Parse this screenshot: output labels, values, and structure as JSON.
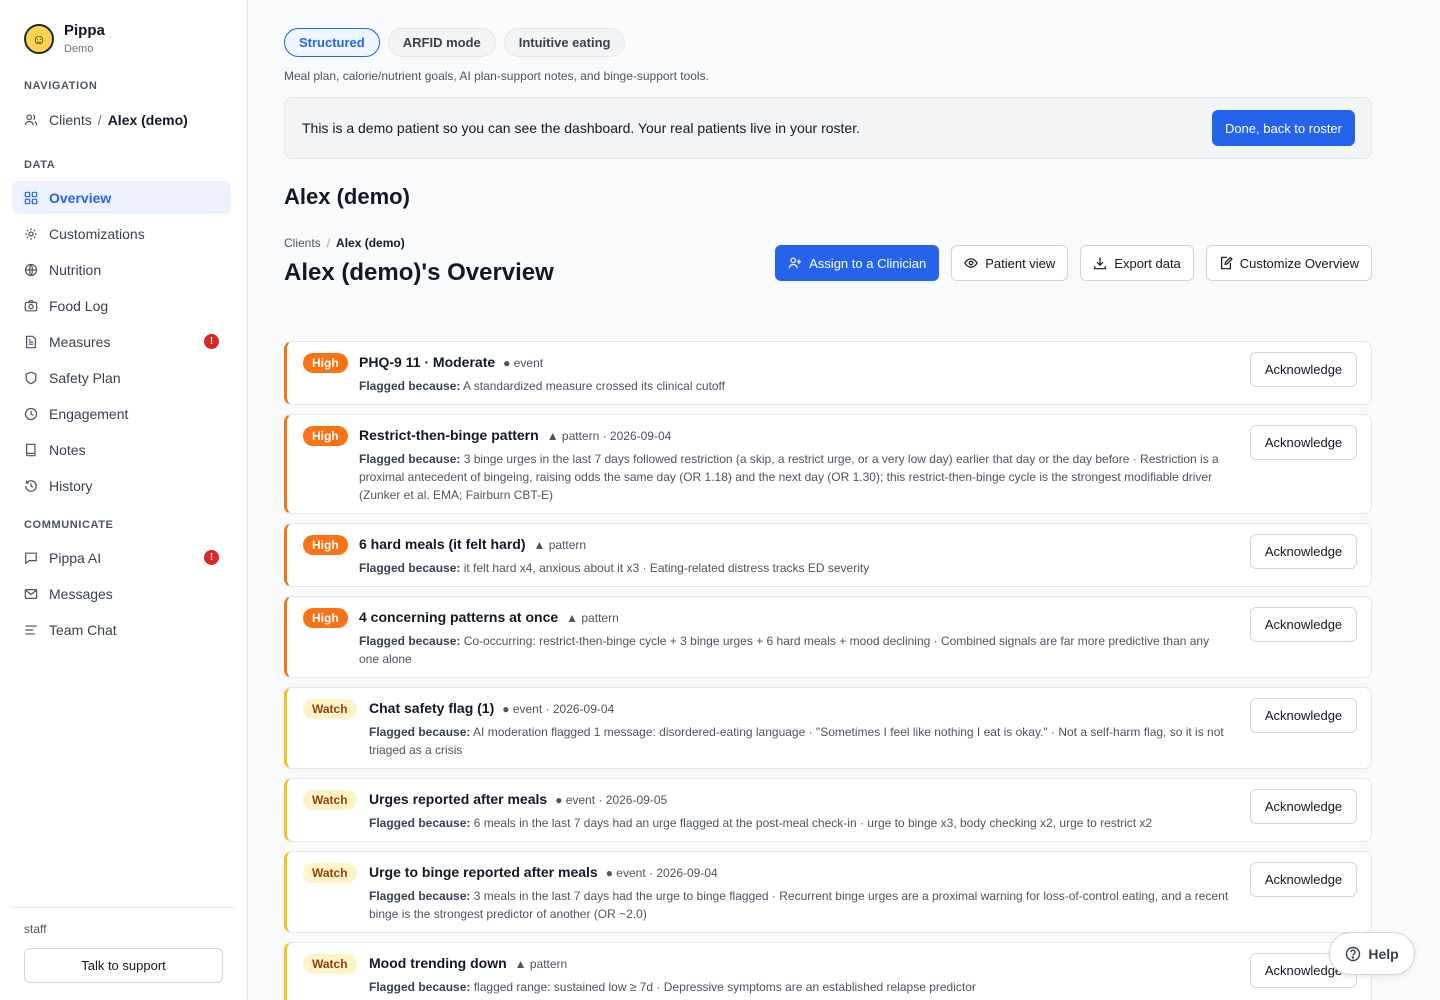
{
  "brand": {
    "name": "Pippa",
    "sub": "Demo"
  },
  "sidebar": {
    "nav_label": "NAVIGATION",
    "crumb": {
      "parent": "Clients",
      "sep": "/",
      "current": "Alex (demo)"
    },
    "data_label": "DATA",
    "data_items": [
      {
        "label": "Overview",
        "icon": "grid-icon"
      },
      {
        "label": "Customizations",
        "icon": "gear-icon"
      },
      {
        "label": "Nutrition",
        "icon": "globe-icon"
      },
      {
        "label": "Food Log",
        "icon": "camera-icon"
      },
      {
        "label": "Measures",
        "icon": "document-icon",
        "badge": "!"
      },
      {
        "label": "Safety Plan",
        "icon": "shield-icon"
      },
      {
        "label": "Engagement",
        "icon": "clock-icon"
      },
      {
        "label": "Notes",
        "icon": "book-icon"
      },
      {
        "label": "History",
        "icon": "history-icon"
      }
    ],
    "communicate_label": "COMMUNICATE",
    "communicate_items": [
      {
        "label": "Pippa AI",
        "icon": "chat-icon",
        "badge": "!"
      },
      {
        "label": "Messages",
        "icon": "mail-icon"
      },
      {
        "label": "Team Chat",
        "icon": "lines-icon"
      }
    ],
    "footer_label": "staff",
    "support_label": "Talk to support"
  },
  "modes": {
    "tabs": [
      "Structured",
      "ARFID mode",
      "Intuitive eating"
    ],
    "active": "Structured",
    "description": "Meal plan, calorie/nutrient goals, AI plan-support notes, and binge-support tools."
  },
  "banner": {
    "text": "This is a demo patient so you can see the dashboard. Your real patients live in your roster.",
    "button": "Done, back to roster"
  },
  "patient": {
    "title": "Alex (demo)"
  },
  "breadcrumb": {
    "parent": "Clients",
    "sep": "/",
    "current": "Alex (demo)"
  },
  "overview_title": "Alex (demo)'s Overview",
  "actions": {
    "assign": "Assign to a Clinician",
    "patient_view": "Patient view",
    "export": "Export data",
    "customize": "Customize Overview"
  },
  "alerts": [
    {
      "severity": "High",
      "title": "PHQ-9 11 · Moderate",
      "meta": "● event",
      "prefix": "Flagged because:",
      "body": "A standardized measure crossed its clinical cutoff"
    },
    {
      "severity": "High",
      "title": "Restrict-then-binge pattern",
      "meta": "▲ pattern · 2026-09-04",
      "prefix": "Flagged because:",
      "body": "3 binge urges in the last 7 days followed restriction (a skip, a restrict urge, or a very low day) earlier that day or the day before · Restriction is a proximal antecedent of bingeing, raising odds the same day (OR 1.18) and the next day (OR 1.30); this restrict-then-binge cycle is the strongest modifiable driver (Zunker et al. EMA; Fairburn CBT-E)"
    },
    {
      "severity": "High",
      "title": "6 hard meals (it felt hard)",
      "meta": "▲ pattern",
      "prefix": "Flagged because:",
      "body": "it felt hard x4, anxious about it x3 · Eating-related distress tracks ED severity"
    },
    {
      "severity": "High",
      "title": "4 concerning patterns at once",
      "meta": "▲ pattern",
      "prefix": "Flagged because:",
      "body": "Co-occurring: restrict-then-binge cycle + 3 binge urges + 6 hard meals + mood declining · Combined signals are far more predictive than any one alone"
    },
    {
      "severity": "Watch",
      "title": "Chat safety flag (1)",
      "meta": "● event · 2026-09-04",
      "prefix": "Flagged because:",
      "body": "AI moderation flagged 1 message: disordered-eating language · \"Sometimes I feel like nothing I eat is okay.\" · Not a self-harm flag, so it is not triaged as a crisis"
    },
    {
      "severity": "Watch",
      "title": "Urges reported after meals",
      "meta": "● event · 2026-09-05",
      "prefix": "Flagged because:",
      "body": "6 meals in the last 7 days had an urge flagged at the post-meal check-in · urge to binge x3, body checking x2, urge to restrict x2"
    },
    {
      "severity": "Watch",
      "title": "Urge to binge reported after meals",
      "meta": "● event · 2026-09-04",
      "prefix": "Flagged because:",
      "body": "3 meals in the last 7 days had the urge to binge flagged · Recurrent binge urges are a proximal warning for loss-of-control eating, and a recent binge is the strongest predictor of another (OR ~2.0)"
    },
    {
      "severity": "Watch",
      "title": "Mood trending down",
      "meta": "▲ pattern",
      "prefix": "Flagged because:",
      "body": "flagged range: sustained low ≥ 7d · Depressive symptoms are an established relapse predictor"
    }
  ],
  "ack_label": "Acknowledge",
  "help_label": "Help",
  "colors": {
    "accent": "#2563eb",
    "high": "#f97316",
    "watch": "#fbbf24",
    "badge": "#dc2626"
  }
}
